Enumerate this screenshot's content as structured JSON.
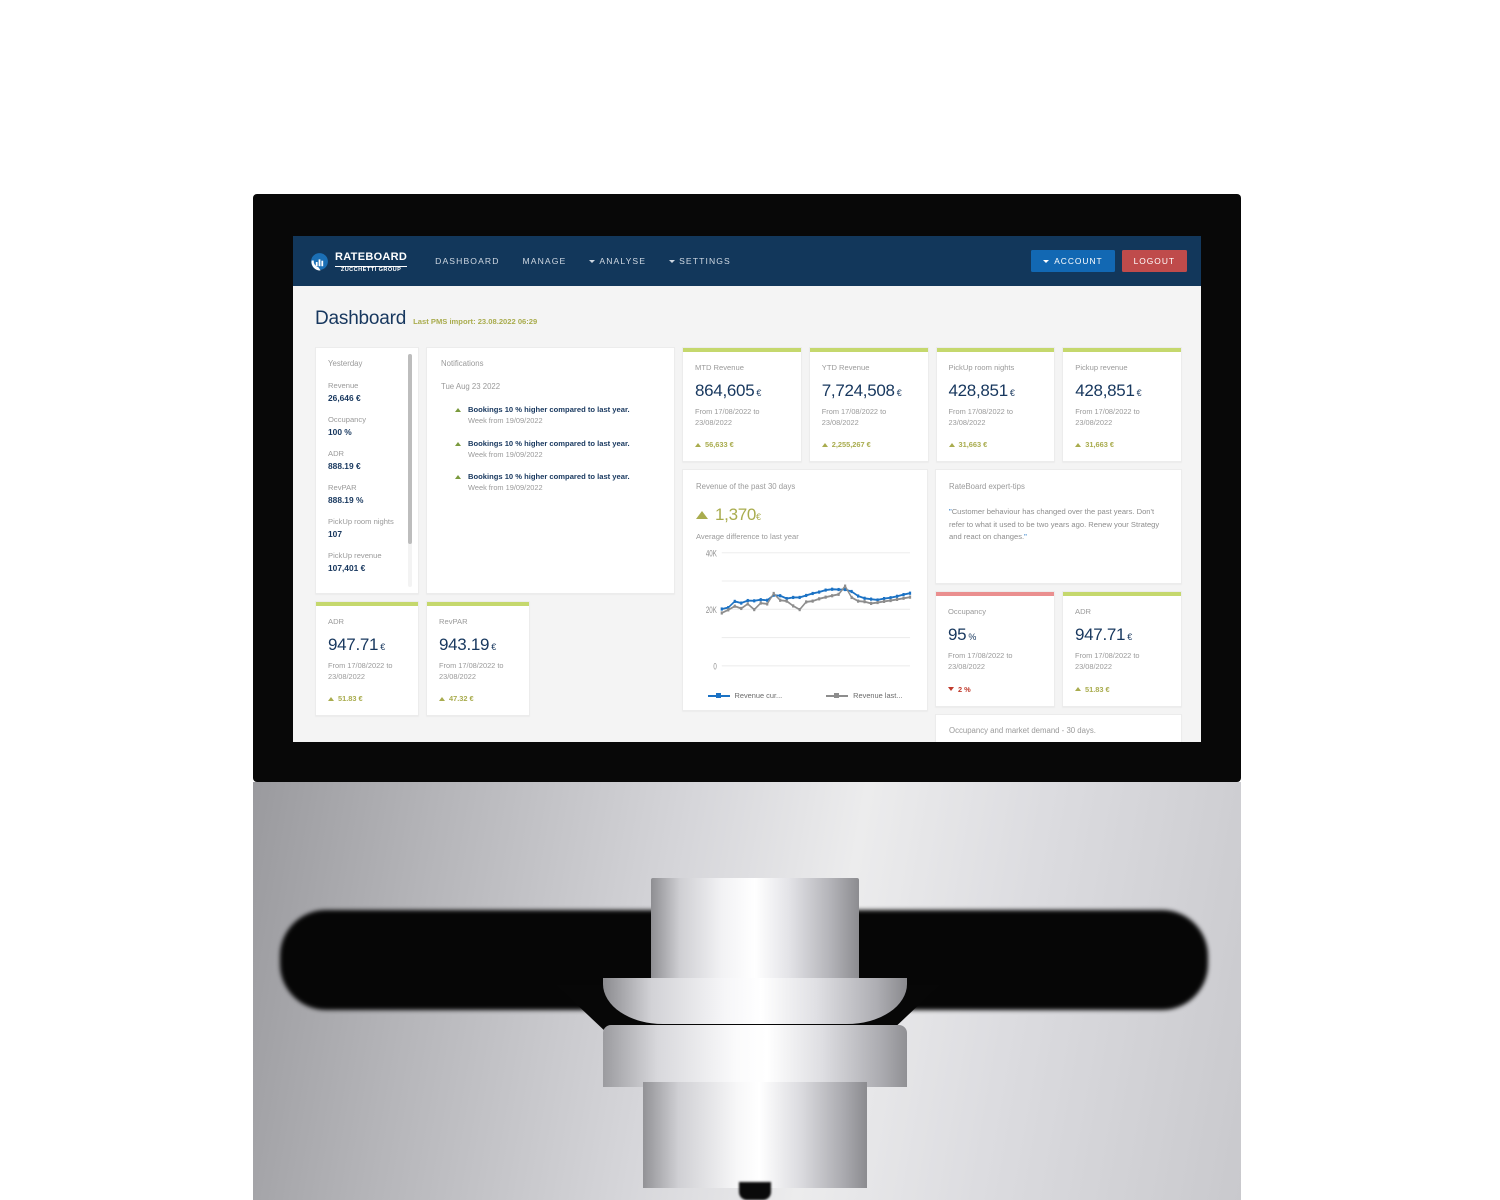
{
  "navbar": {
    "logo_title": "RATEBOARD",
    "logo_sub": "ZUCCHETTI GROUP",
    "links": [
      {
        "label": "DASHBOARD",
        "caret": false
      },
      {
        "label": "MANAGE",
        "caret": false
      },
      {
        "label": "ANALYSE",
        "caret": true
      },
      {
        "label": "SETTINGS",
        "caret": true
      }
    ],
    "account_label": "ACCOUNT",
    "logout_label": "LOGOUT"
  },
  "page": {
    "title": "Dashboard",
    "subtitle": "Last PMS import: 23.08.2022 06:29"
  },
  "yesterday": {
    "title": "Yesterday",
    "items": [
      {
        "key": "Revenue",
        "value": "26,646 €"
      },
      {
        "key": "Occupancy",
        "value": "100 %"
      },
      {
        "key": "ADR",
        "value": "888.19 €"
      },
      {
        "key": "RevPAR",
        "value": "888.19 %"
      },
      {
        "key": "PickUp room nights",
        "value": "107"
      },
      {
        "key": "PickUp revenue",
        "value": "107,401 €"
      }
    ]
  },
  "notifications": {
    "title": "Notifications",
    "date": "Tue Aug 23 2022",
    "items": [
      {
        "headline": "Bookings 10 % higher compared to last year.",
        "sub": "Week from 19/09/2022"
      },
      {
        "headline": "Bookings 10 % higher compared to last year.",
        "sub": "Week from 19/09/2022"
      },
      {
        "headline": "Bookings 10 % higher compared to last year.",
        "sub": "Week from 19/09/2022"
      }
    ]
  },
  "kpis_top": [
    {
      "label": "MTD Revenue",
      "value": "864,605",
      "unit": "€",
      "range": "From 17/08/2022 to 23/08/2022",
      "delta": "56,633 €",
      "dir": "up",
      "accent": "#c5d86d"
    },
    {
      "label": "YTD Revenue",
      "value": "7,724,508",
      "unit": "€",
      "range": "From 17/08/2022 to 23/08/2022",
      "delta": "2,255,267 €",
      "dir": "up",
      "accent": "#c5d86d"
    },
    {
      "label": "PickUp room nights",
      "value": "428,851",
      "unit": "€",
      "range": "From 17/08/2022 to 23/08/2022",
      "delta": "31,663 €",
      "dir": "up",
      "accent": "#c5d86d"
    },
    {
      "label": "Pickup revenue",
      "value": "428,851",
      "unit": "€",
      "range": "From 17/08/2022 to 23/08/2022",
      "delta": "31,663 €",
      "dir": "up",
      "accent": "#c5d86d"
    }
  ],
  "kpis_bottom_left": [
    {
      "label": "ADR",
      "value": "947.71",
      "unit": "€",
      "range": "From 17/08/2022 to 23/08/2022",
      "delta": "51.83 €",
      "dir": "up",
      "accent": "#c5d86d"
    },
    {
      "label": "RevPAR",
      "value": "943.19",
      "unit": "€",
      "range": "From 17/08/2022 to 23/08/2022",
      "delta": "47.32 €",
      "dir": "up",
      "accent": "#c5d86d"
    }
  ],
  "kpis_bottom_right": [
    {
      "label": "Occupancy",
      "value": "95",
      "unit": "%",
      "range": "From 17/08/2022 to 23/08/2022",
      "delta": "2 %",
      "dir": "down",
      "accent": "#ea8f8f"
    },
    {
      "label": "ADR",
      "value": "947.71",
      "unit": "€",
      "range": "From 17/08/2022 to 23/08/2022",
      "delta": "51.83 €",
      "dir": "up",
      "accent": "#c5d86d"
    }
  ],
  "revenue_panel": {
    "title": "Revenue of the past 30 days",
    "big_value": "1,370",
    "big_unit": "€",
    "big_dir": "up",
    "caption": "Average difference to last year"
  },
  "tips": {
    "title": "RateBoard expert-tips",
    "quote_open": "\"",
    "text": "Customer behaviour has changed over the past years. Don't refer to what it used to be two years ago. Renew your Strategy and react on changes.",
    "quote_close": "\""
  },
  "occupancy_panel": {
    "title": "Occupancy and market demand - 30 days."
  },
  "colors": {
    "navy": "#12375b",
    "accent_green": "#c5d86d",
    "accent_red": "#ea8f8f",
    "olive_text": "#a9ac4e",
    "blue_series": "#1b72c4",
    "grey_series": "#8d8d8d",
    "page_bg": "#f4f4f4"
  },
  "chart_data": {
    "type": "line",
    "title": "Revenue of the past 30 days",
    "xlabel": "",
    "ylabel": "",
    "ylim": [
      0,
      40000
    ],
    "yticks": [
      0,
      20000,
      40000
    ],
    "ytick_labels": [
      "0",
      "20K",
      "40K"
    ],
    "grid": true,
    "legend_position": "bottom",
    "x": [
      1,
      2,
      3,
      4,
      5,
      6,
      7,
      8,
      9,
      10,
      11,
      12,
      13,
      14,
      15,
      16,
      17,
      18,
      19,
      20,
      21,
      22,
      23,
      24,
      25,
      26,
      27,
      28,
      29,
      30
    ],
    "series": [
      {
        "name": "Revenue cur...",
        "color": "#1b72c4",
        "values": [
          20100,
          20600,
          22800,
          22200,
          23100,
          23000,
          23400,
          23200,
          25000,
          24800,
          23800,
          24200,
          24200,
          24900,
          25600,
          26100,
          26800,
          27100,
          27000,
          27000,
          26300,
          24700,
          23900,
          23600,
          23300,
          23800,
          24100,
          24600,
          25200,
          25700
        ]
      },
      {
        "name": "Revenue last...",
        "color": "#8d8d8d",
        "values": [
          18700,
          19800,
          21100,
          20300,
          21900,
          19900,
          22200,
          21900,
          25600,
          23200,
          22900,
          21200,
          19900,
          22600,
          22900,
          23700,
          24300,
          24800,
          25300,
          28200,
          24200,
          22900,
          22700,
          22100,
          22400,
          22800,
          23100,
          23500,
          23900,
          24300
        ]
      }
    ]
  }
}
